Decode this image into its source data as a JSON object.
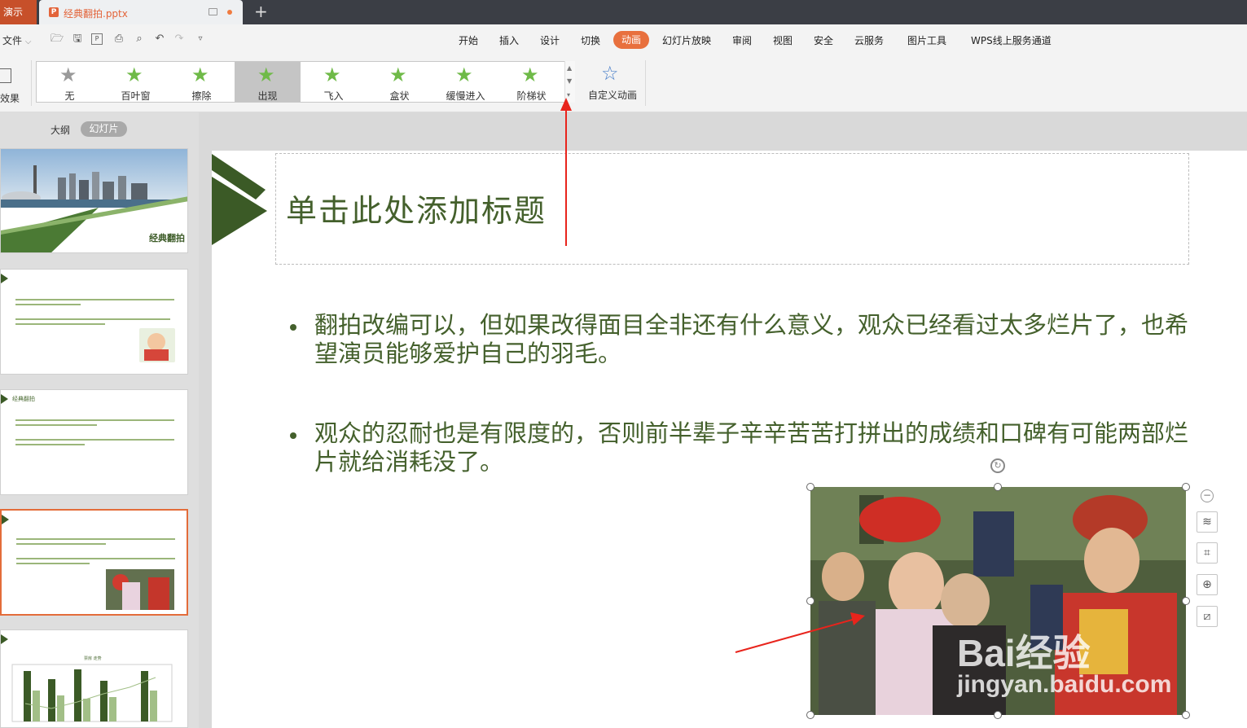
{
  "titlebar": {
    "app_tab": "演示",
    "doc_tab": {
      "name": "经典翻拍.pptx",
      "icon": "ppt-file-icon"
    },
    "new_tab": "+"
  },
  "menubar": {
    "file_label": "文件",
    "quick_access_icons": [
      "open-folder-icon",
      "save-icon",
      "export-pdf-icon",
      "print-icon",
      "print-preview-icon",
      "undo-icon",
      "redo-icon",
      "customize-icon"
    ],
    "tabs": [
      {
        "label": "开始",
        "active": false
      },
      {
        "label": "插入",
        "active": false
      },
      {
        "label": "设计",
        "active": false
      },
      {
        "label": "切换",
        "active": false
      },
      {
        "label": "动画",
        "active": true
      },
      {
        "label": "幻灯片放映",
        "active": false
      },
      {
        "label": "审阅",
        "active": false
      },
      {
        "label": "视图",
        "active": false
      },
      {
        "label": "安全",
        "active": false
      },
      {
        "label": "云服务",
        "active": false
      },
      {
        "label": "图片工具",
        "active": false
      },
      {
        "label": "WPS线上服务通道",
        "active": false
      }
    ],
    "active_color": "#e8703e"
  },
  "ribbon": {
    "effect_label": "效果",
    "gallery": [
      {
        "label": "无",
        "selected": false
      },
      {
        "label": "百叶窗",
        "selected": false
      },
      {
        "label": "擦除",
        "selected": false
      },
      {
        "label": "出现",
        "selected": true
      },
      {
        "label": "飞入",
        "selected": false
      },
      {
        "label": "盒状",
        "selected": false
      },
      {
        "label": "缓慢进入",
        "selected": false
      },
      {
        "label": "阶梯状",
        "selected": false
      }
    ],
    "custom_animation_label": "自定义动画"
  },
  "left_panel": {
    "view_outline": "大纲",
    "view_slides": "幻灯片",
    "thumb1_title": "经典翻拍",
    "thumb3_title": "经典翻拍",
    "thumb5_chart_title": "票房 走势"
  },
  "slide": {
    "title": "单击此处添加标题",
    "bullets": [
      "翻拍改编可以，但如果改得面目全非还有什么意义，观众已经看过太多烂片了，也希望演员能够爱护自己的羽毛。",
      "观众的忍耐也是有限度的，否则前半辈子辛辛苦苦打拼出的成绩和口碑有可能两部烂片就给消耗没了。"
    ],
    "accent_color": "#44602c"
  },
  "picture": {
    "watermark": "Bai经验",
    "watermark_url": "jingyan.baidu.com"
  },
  "annotations": {
    "arrow_color": "#e8241c"
  }
}
